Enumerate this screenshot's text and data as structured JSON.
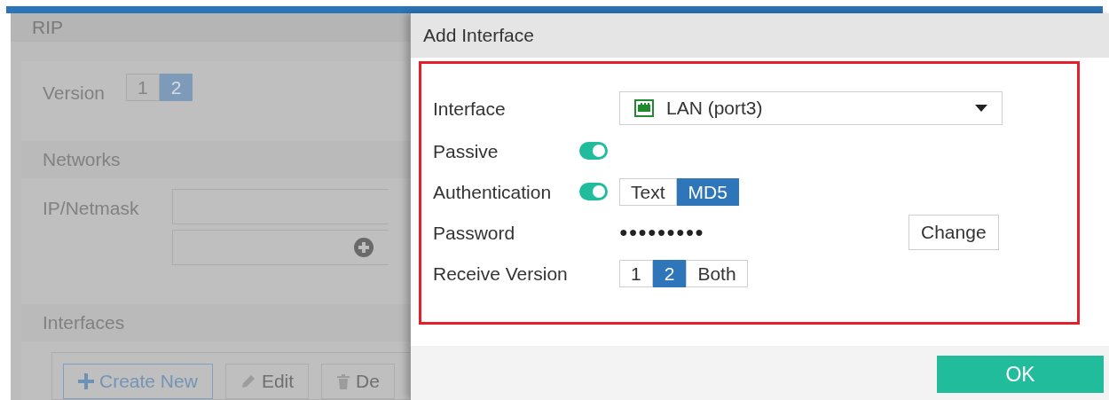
{
  "background_panel": {
    "title": "RIP",
    "version": {
      "label": "Version",
      "options": [
        {
          "label": "1",
          "selected": false
        },
        {
          "label": "2",
          "selected": true
        }
      ]
    },
    "networks": {
      "title": "Networks",
      "ip_label": "IP/Netmask"
    },
    "interfaces": {
      "title": "Interfaces",
      "toolbar": [
        {
          "label": "Create New",
          "kind": "create"
        },
        {
          "label": "Edit",
          "kind": "edit"
        },
        {
          "label": "De",
          "kind": "delete"
        }
      ]
    }
  },
  "dialog": {
    "title": "Add Interface",
    "interface": {
      "label": "Interface",
      "value": "LAN (port3)"
    },
    "passive": {
      "label": "Passive",
      "on": true
    },
    "authentication": {
      "label": "Authentication",
      "on": true,
      "options": [
        {
          "label": "Text",
          "selected": false
        },
        {
          "label": "MD5",
          "selected": true
        }
      ]
    },
    "password": {
      "label": "Password",
      "value": "●●●●●●●●●",
      "button": "Change"
    },
    "receive_version": {
      "label": "Receive Version",
      "options": [
        {
          "label": "1",
          "selected": false
        },
        {
          "label": "2",
          "selected": true
        },
        {
          "label": "Both",
          "selected": false
        }
      ]
    },
    "ok_button": "OK"
  }
}
